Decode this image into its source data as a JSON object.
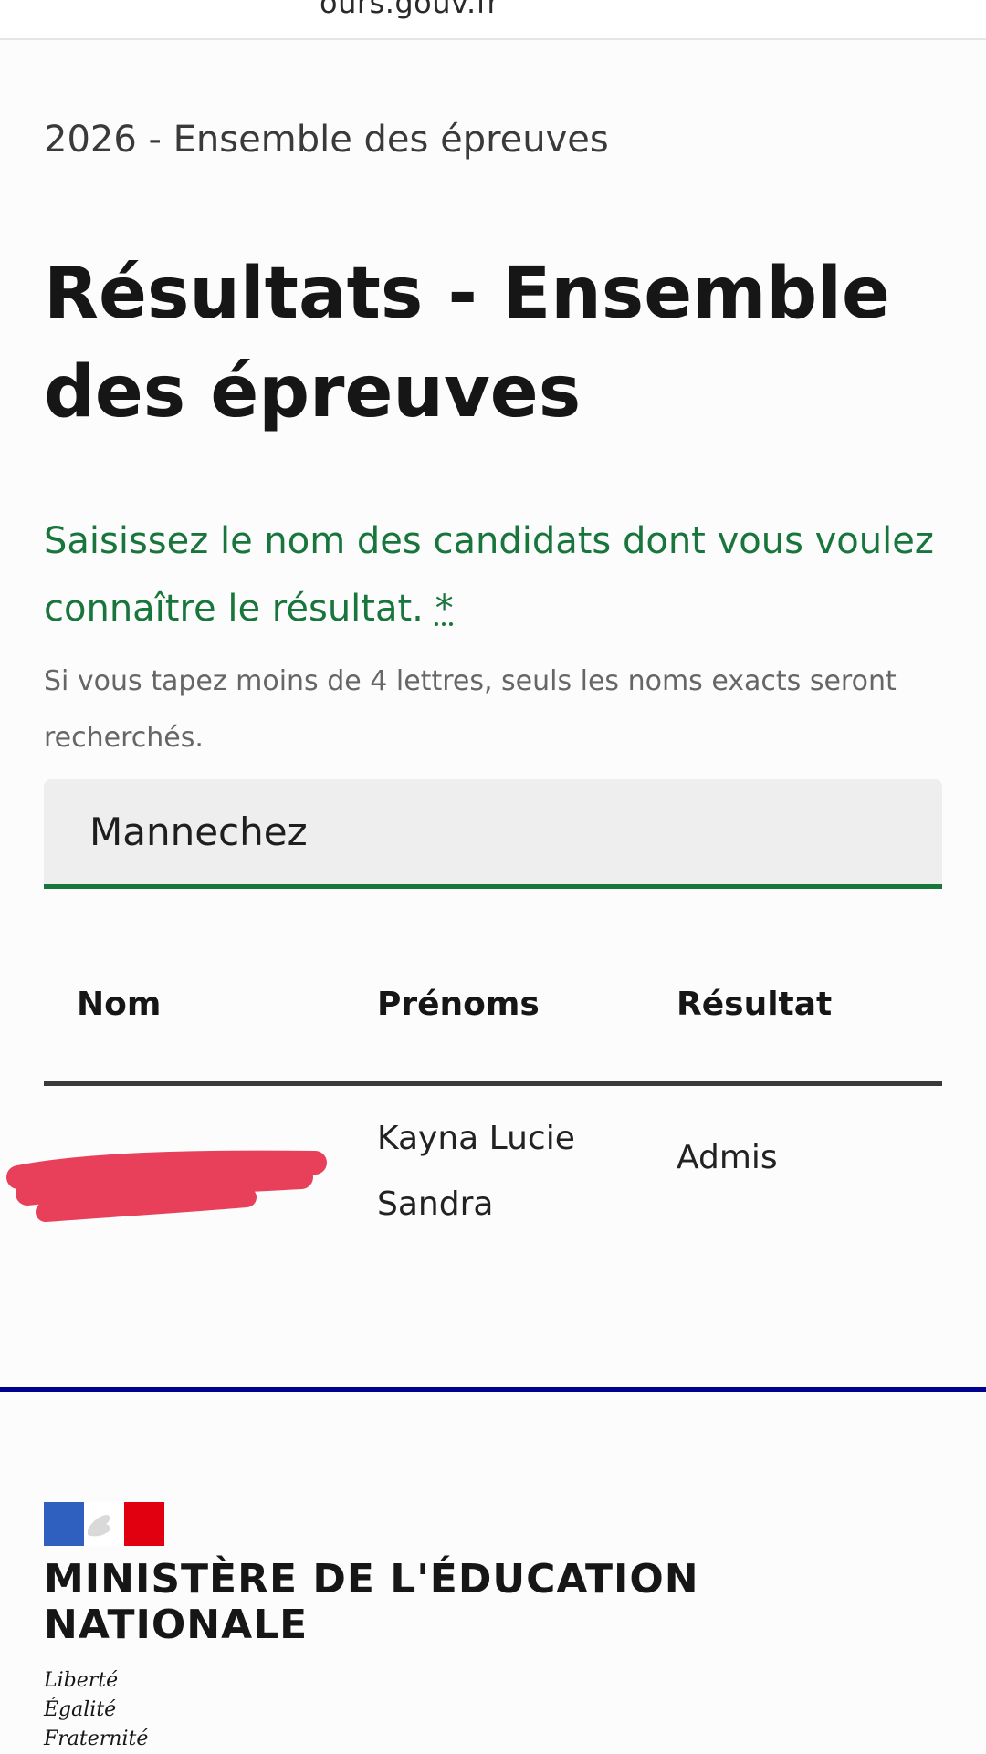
{
  "browser": {
    "url": "ours.gouv.fr"
  },
  "breadcrumb": "2026 - Ensemble des épreuves",
  "page_title": "Résultats - Ensemble des épreuves",
  "search": {
    "label": "Saisissez le nom des candidats dont vous voulez connaître le résultat.",
    "required_marker": "*",
    "hint": "Si vous tapez moins de 4 lettres, seuls les noms exacts seront recherchés.",
    "value": "Mannechez"
  },
  "table": {
    "headers": {
      "nom": "Nom",
      "prenoms": "Prénoms",
      "resultat": "Résultat"
    },
    "rows": [
      {
        "prenoms": "Kayna Lucie Sandra",
        "resultat": "Admis"
      }
    ]
  },
  "footer": {
    "ministry": "MINISTÈRE DE L'ÉDUCATION NATIONALE",
    "motto_1": "Liberté",
    "motto_2": "Égalité",
    "motto_3": "Fraternité"
  },
  "colors": {
    "accent_green": "#18753c",
    "footer_blue": "#000091",
    "redaction": "#e8405a"
  }
}
